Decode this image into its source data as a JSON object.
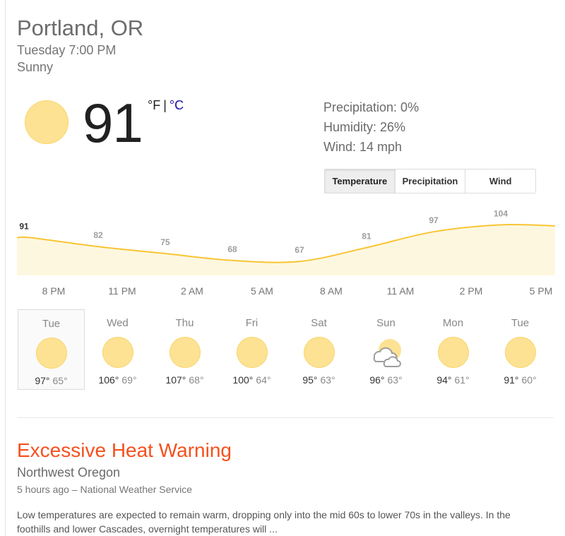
{
  "location": "Portland, OR",
  "datetime": "Tuesday 7:00 PM",
  "condition": "Sunny",
  "current": {
    "temp": "91",
    "unit_f": "°F",
    "unit_sep": "|",
    "unit_c": "°C",
    "icon": "sun-icon"
  },
  "details": {
    "precipitation": "Precipitation: 0%",
    "humidity": "Humidity: 26%",
    "wind": "Wind: 14 mph"
  },
  "tabs": [
    {
      "label": "Temperature",
      "active": true
    },
    {
      "label": "Precipitation",
      "active": false
    },
    {
      "label": "Wind",
      "active": false
    }
  ],
  "colors": {
    "sun": "#fde293",
    "line": "#f8c534",
    "area": "#fef7e0",
    "alert": "#f4511e",
    "link": "#1a0dab"
  },
  "chart_data": {
    "type": "area",
    "x": [
      "8 PM",
      "11 PM",
      "2 AM",
      "5 AM",
      "8 AM",
      "11 AM",
      "2 PM",
      "5 PM"
    ],
    "values": [
      91,
      82,
      75,
      68,
      67,
      81,
      97,
      104
    ],
    "labels": [
      "91",
      "82",
      "75",
      "68",
      "67",
      "81",
      "97",
      "104"
    ]
  },
  "forecast": [
    {
      "day": "Tue",
      "hi": "97°",
      "lo": "65°",
      "icon": "sun-icon",
      "selected": true
    },
    {
      "day": "Wed",
      "hi": "106°",
      "lo": "69°",
      "icon": "sun-icon"
    },
    {
      "day": "Thu",
      "hi": "107°",
      "lo": "68°",
      "icon": "sun-icon"
    },
    {
      "day": "Fri",
      "hi": "100°",
      "lo": "64°",
      "icon": "sun-icon"
    },
    {
      "day": "Sat",
      "hi": "95°",
      "lo": "63°",
      "icon": "sun-icon"
    },
    {
      "day": "Sun",
      "hi": "96°",
      "lo": "63°",
      "icon": "partly-cloudy-icon"
    },
    {
      "day": "Mon",
      "hi": "94°",
      "lo": "61°",
      "icon": "sun-icon"
    },
    {
      "day": "Tue",
      "hi": "91°",
      "lo": "60°",
      "icon": "sun-icon"
    }
  ],
  "alert": {
    "title": "Excessive Heat Warning",
    "region": "Northwest Oregon",
    "source": "5 hours ago – National Weather Service",
    "body": "Low temperatures are expected to remain warm, dropping only into the mid 60s to lower 70s in the valleys. In the foothills and lower Cascades, overnight temperatures will ..."
  }
}
